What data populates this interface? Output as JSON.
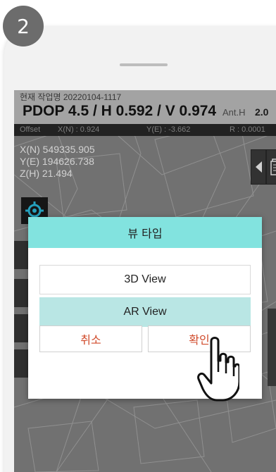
{
  "step_badge": "2",
  "status": {
    "job_name": "현재 작업명 20220104-1117",
    "pdop_text": "PDOP 4.5 / H 0.592 / V 0.974",
    "anth_label": "Ant.H",
    "anth_value": "2.0"
  },
  "offset_bar": {
    "offset_label": "Offset",
    "x": "X(N) : 0.924",
    "y": "Y(E) : -3.662",
    "r": "R : 0.0001"
  },
  "coords": {
    "x": "X(N) 549335.905",
    "y": "Y(E) 194626.738",
    "z": "Z(H) 21.494"
  },
  "dialog": {
    "title": "뷰 타입",
    "options": [
      "3D View",
      "AR View"
    ],
    "selected": "AR View",
    "cancel_label": "취소",
    "confirm_label": "확인"
  },
  "colors": {
    "dialog_header": "#82e3df",
    "selected_option": "#b9e6e4",
    "action_text": "#d04a2a"
  },
  "icons": [
    "gps-target-icon",
    "back-arrow-icon",
    "document-icon",
    "pointer-hand-icon"
  ]
}
